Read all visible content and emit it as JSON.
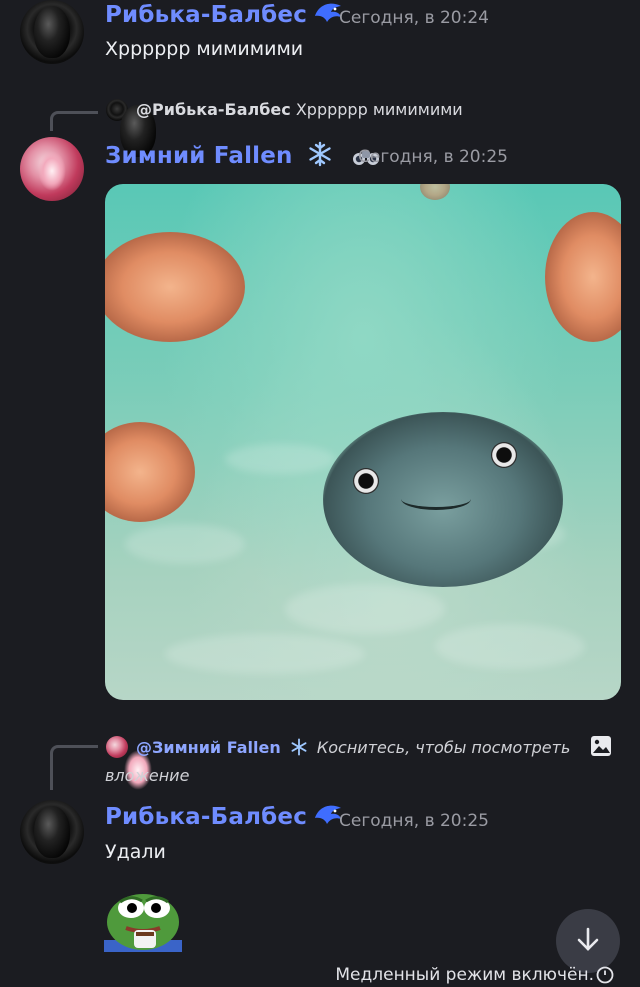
{
  "messages": [
    {
      "author": "Рибька-Балбес",
      "time": "Сегодня, в 20:24",
      "text": "Хрррррр мимимими"
    },
    {
      "reply": {
        "author": "@Рибька-Балбес",
        "text": "Хрррррр мимимими"
      },
      "author": "Зимний Fallen",
      "time": "Сегодня, в 20:25",
      "attachment": "video"
    },
    {
      "reply": {
        "author": "@Зимний Fallen",
        "text_line1": "Коснитесь, чтобы посмотреть",
        "text_line2": "вложение"
      },
      "author": "Рибька-Балбес",
      "time": "Сегодня, в 20:25",
      "text": "Удали",
      "sticker": "pepe-coffee"
    }
  ],
  "footer": {
    "slowmode": "Медленный режим включён."
  },
  "icons": {
    "author_badge": "blue-bird-icon",
    "snowflake": "snowflake-icon",
    "binoculars": "binoculars-icon",
    "scroll_down": "arrow-down-icon",
    "clock": "clock-icon",
    "image": "image-icon"
  },
  "colors": {
    "background": "#1b1c21",
    "username": "#6f8cff",
    "timestamp": "#9a9ba3"
  }
}
